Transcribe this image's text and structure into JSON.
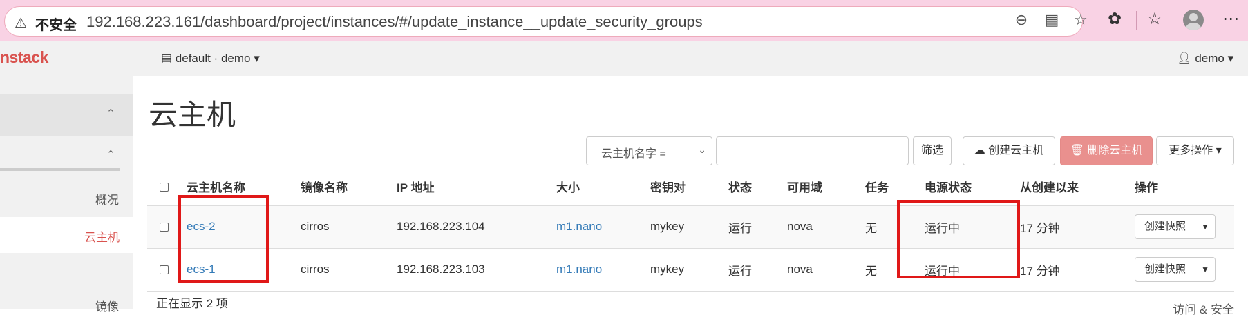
{
  "browser": {
    "unsafe_label": "不安全",
    "url": "192.168.223.161/dashboard/project/instances/#/update_instance__update_security_groups"
  },
  "topnav": {
    "logo": "nstack",
    "project": "default · demo ▾",
    "user": "demo ▾"
  },
  "sidebar": {
    "items": [
      "概况",
      "云主机",
      "镜像",
      "访问 & 安全"
    ]
  },
  "page": {
    "title": "云主机"
  },
  "toolbar": {
    "filter_field": "云主机名字 =",
    "filter_value": "",
    "filter_button": "筛选",
    "create_button": "创建云主机",
    "delete_button": "删除云主机",
    "more_button": "更多操作 ▾"
  },
  "table": {
    "headers": [
      "云主机名称",
      "镜像名称",
      "IP 地址",
      "大小",
      "密钥对",
      "状态",
      "可用域",
      "任务",
      "电源状态",
      "从创建以来",
      "操作"
    ],
    "rows": [
      {
        "name": "ecs-2",
        "image": "cirros",
        "ip": "192.168.223.104",
        "size": "m1.nano",
        "keypair": "mykey",
        "status": "运行",
        "zone": "nova",
        "task": "无",
        "power": "运行中",
        "age": "17 分钟",
        "action": "创建快照"
      },
      {
        "name": "ecs-1",
        "image": "cirros",
        "ip": "192.168.223.103",
        "size": "m1.nano",
        "keypair": "mykey",
        "status": "运行",
        "zone": "nova",
        "task": "无",
        "power": "运行中",
        "age": "17 分钟",
        "action": "创建快照"
      }
    ],
    "footer": "正在显示 2 项"
  },
  "colors": {
    "highlight": "#e01818",
    "link": "#337ab7",
    "danger": "#e9908e",
    "browser_bar": "#f9d2e4"
  }
}
